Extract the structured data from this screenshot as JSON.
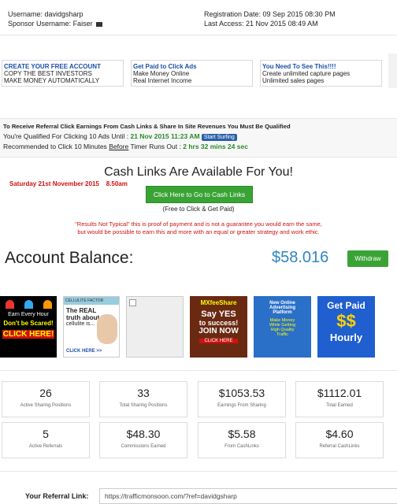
{
  "user": {
    "username_label": "Username:",
    "username": "davidgsharp",
    "sponsor_label": "Sponsor Username:",
    "sponsor": "Faiser",
    "registration": "Registration Date: 09 Sep 2015 08:30 PM",
    "last_access": "Last Access: 21 Nov 2015 08:49 AM"
  },
  "promos": [
    {
      "title": "CREATE YOUR FREE ACCOUNT",
      "line1": "COPY THE BEST INVESTORS",
      "line2": "MAKE MONEY AUTOMATICALLY"
    },
    {
      "title": "Get Paid to Click Ads",
      "line1": "Make Money Online",
      "line2": "Real Internet Income"
    },
    {
      "title": "You Need To See This!!!!",
      "line1": "Create unlimited capture pages",
      "line2": "Unlimited sales pages"
    }
  ],
  "qualify": {
    "heading": "To Receive Referral Click Earnings From Cash Links & Share In Site Revenues You Must Be Qualified",
    "line1_prefix": "You're Qualified For Clicking 10 Ads Until :",
    "line1_date": "21 Nov 2015 11:23 AM",
    "start_button": "Start Surfing",
    "line2_prefix": "Recommended to Click 10 Minutes",
    "line2_before": "Before",
    "line2_middle": "Timer Runs Out :",
    "line2_timer": "2 hrs 32 mins 24 sec"
  },
  "cashlinks": {
    "headline": "Cash Links Are Available For You!",
    "date": "Saturday 21st November 2015",
    "time": "8.50am",
    "button": "Click Here to Go to Cash Links",
    "sub": "(Free to Click & Get Paid)",
    "disclaimer1": "\"Results Not Typical\" this is proof of payment and is not a guarantee you would earn the same,",
    "disclaimer2": "but would be possible to earn this and more with an equal or greater strategy and work ethic."
  },
  "balance": {
    "label": "Account Balance:",
    "amount": "$58.016",
    "withdraw": "Withdraw"
  },
  "ads": {
    "a1_top": "Earn Every Hour",
    "a1_mid": "Don't be Scared!",
    "a1_bottom": "CLICK HERE!",
    "a2_brand": "CELLULITE FACTOR",
    "a2_text1": "The REAL",
    "a2_text2": "truth about",
    "a2_text3": "cellulite is...",
    "a2_cta": "CLICK HERE >>",
    "a4_brand": "MXfeeShare",
    "a4_line1": "Say YES",
    "a4_line2": "to success!",
    "a4_line3": "JOIN NOW",
    "a4_cta": "CLICK HERE",
    "a5_line1": "New Online",
    "a5_line2": "Advertising",
    "a5_line3": "Platform",
    "a5_line4": "Make Money",
    "a5_line5": "While Getting",
    "a5_line6": "High Quality",
    "a5_line7": "Traffic",
    "a6_line1": "Get Paid",
    "a6_line2": "$$",
    "a6_line3": "Hourly"
  },
  "stats": [
    {
      "value": "26",
      "label": "Active Sharing Positions"
    },
    {
      "value": "33",
      "label": "Total Sharing Positions"
    },
    {
      "value": "$1053.53",
      "label": "Earnings From Sharing"
    },
    {
      "value": "$1112.01",
      "label": "Total Earned"
    },
    {
      "value": "5",
      "label": "Active Referrals"
    },
    {
      "value": "$48.30",
      "label": "Commissions Earned"
    },
    {
      "value": "$5.58",
      "label": "From CashLinks"
    },
    {
      "value": "$4.60",
      "label": "Referral CashLinks"
    }
  ],
  "referral": {
    "label": "Your Referral Link:",
    "url": "https://trafficmonsoon.com/?ref=davidgsharp"
  },
  "colors": {
    "accent_blue": "#2e86c1",
    "green": "#3aa335",
    "red": "#d01010"
  }
}
